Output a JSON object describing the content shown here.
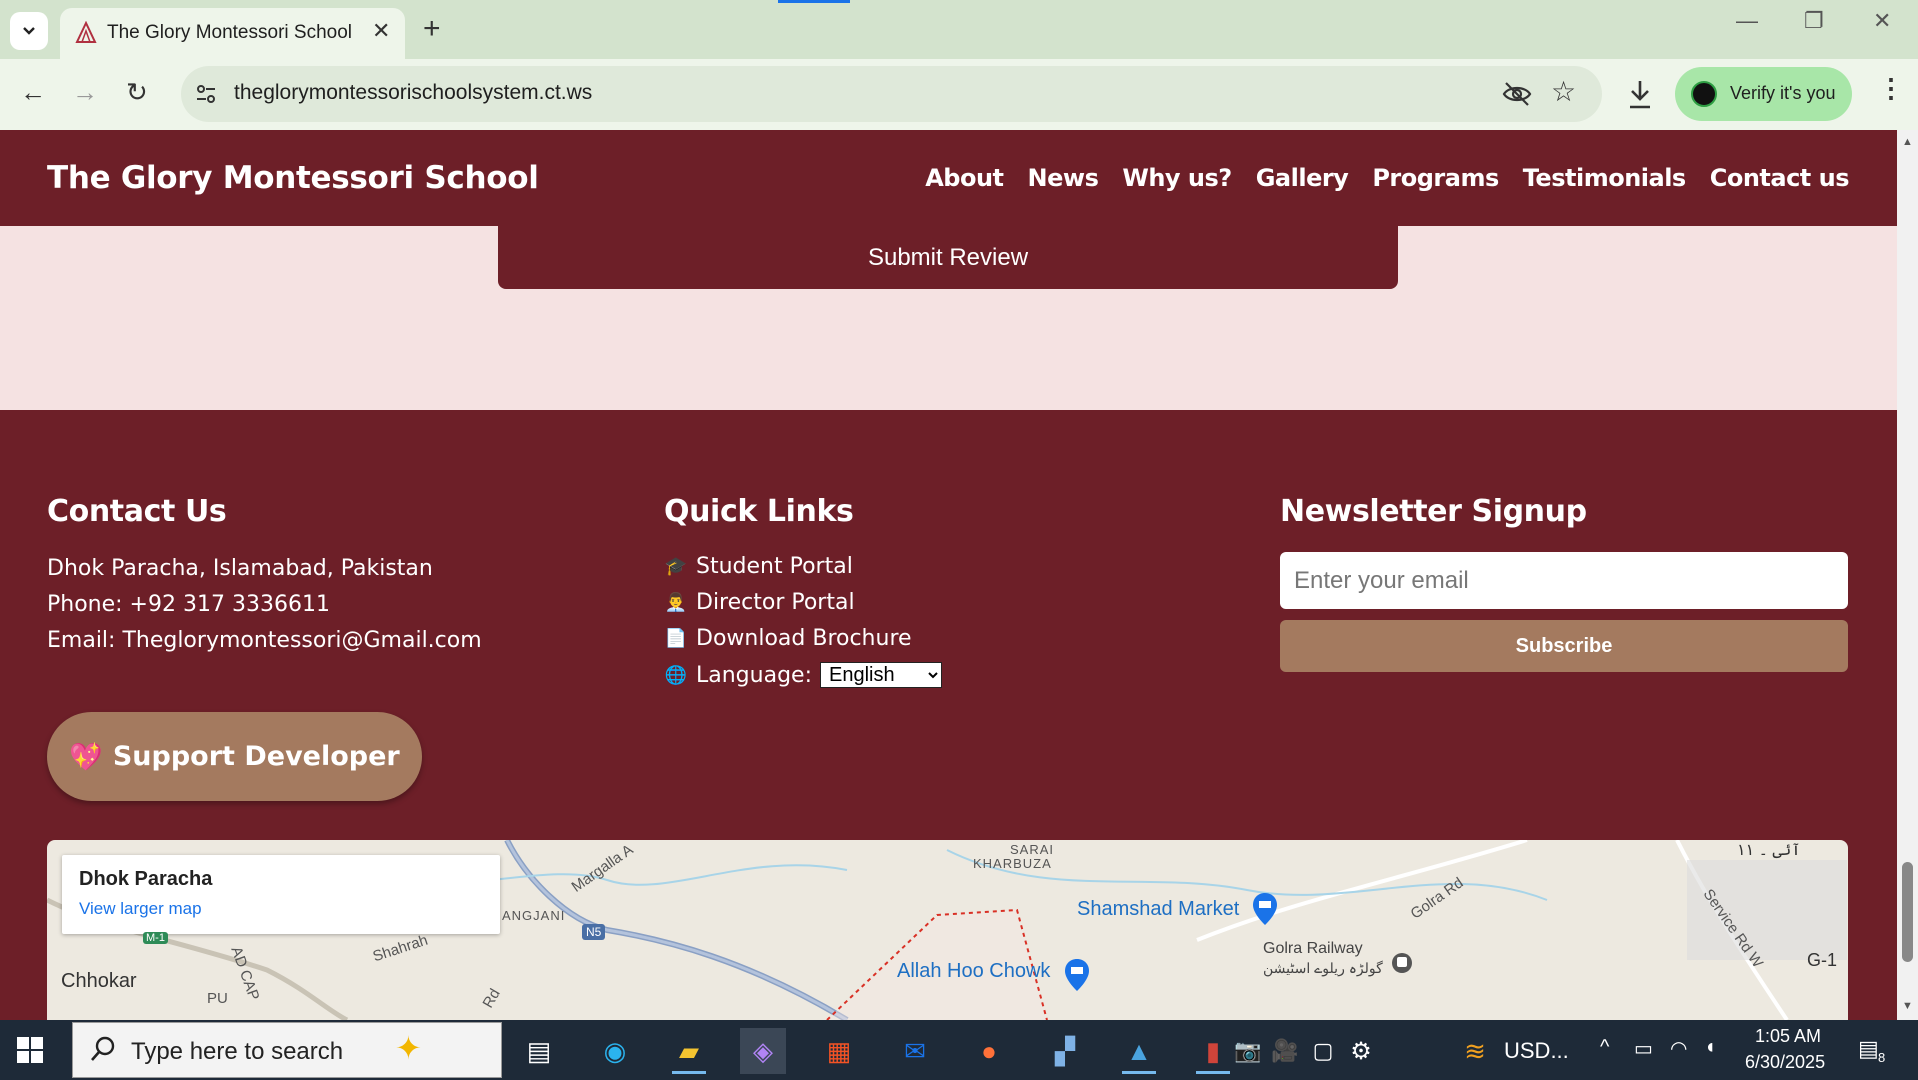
{
  "browser": {
    "tab_title": "The Glory Montessori School Sy",
    "url": "theglorymontessorischoolsystem.ct.ws",
    "verify_label": "Verify it's you"
  },
  "site": {
    "brand": "The Glory Montessori School",
    "nav": [
      "About",
      "News",
      "Why us?",
      "Gallery",
      "Programs",
      "Testimonials",
      "Contact us"
    ]
  },
  "review": {
    "submit_label": "Submit Review"
  },
  "footer": {
    "contact": {
      "title": "Contact Us",
      "address": "Dhok Paracha, Islamabad, Pakistan",
      "phone": "Phone: +92 317 3336611",
      "email": "Email: Theglorymontessori@Gmail.com"
    },
    "quick_links": {
      "title": "Quick Links",
      "items": [
        {
          "icon": "🎓",
          "label": "Student Portal"
        },
        {
          "icon": "👨‍💼",
          "label": "Director Portal"
        },
        {
          "icon": "📄",
          "label": "Download Brochure"
        }
      ],
      "language_icon": "🌐",
      "language_label": "Language:",
      "language_value": "English"
    },
    "newsletter": {
      "title": "Newsletter Signup",
      "placeholder": "Enter your email",
      "subscribe_label": "Subscribe"
    },
    "support": {
      "icon": "💖",
      "label": "Support Developer"
    }
  },
  "map": {
    "place_title": "Dhok Paracha",
    "larger_map_link": "View larger map",
    "labels": {
      "sarai": "SARAI",
      "kharbuza": "KHARBUZA",
      "sangjani": "ANGJANI",
      "margalla": "Margalla A",
      "n5": "N5",
      "shahrah": "Shahrah",
      "chokhar": "Chhokar",
      "shamshad": "Shamshad Market",
      "allah_hoo": "Allah Hoo Chowk",
      "golra": "Golra Railway",
      "golra_urdu": "گولڑہ ریلوے اسٹیشن",
      "golra_rd": "Golra Rd",
      "service_rd": "Service Rd W",
      "g1": "G-1",
      "i11": "آئی ۔ ١١",
      "m1": "M-1",
      "rd": "Rd",
      "ad_cap": "AD CAP",
      "pu": "PU"
    }
  },
  "taskbar": {
    "search_placeholder": "Type here to search",
    "weather": "USD...",
    "time": "1:05 AM",
    "date": "6/30/2025",
    "notifications": "8"
  }
}
